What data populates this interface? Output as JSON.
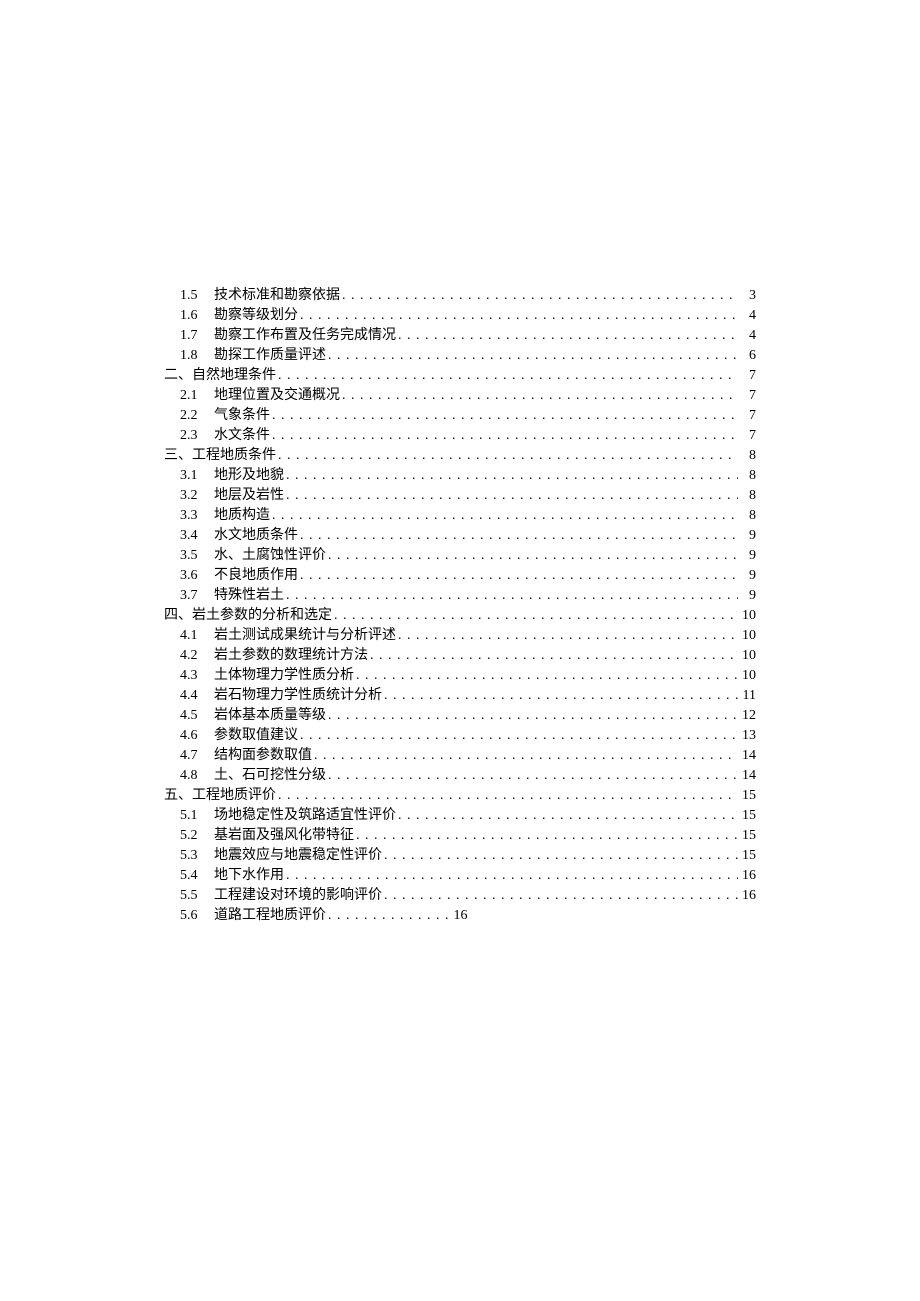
{
  "toc": [
    {
      "type": "sub",
      "num": "1.5",
      "title": "技术标准和勘察依据",
      "page": "3"
    },
    {
      "type": "sub",
      "num": "1.6",
      "title": "勘察等级划分",
      "page": "4"
    },
    {
      "type": "sub",
      "num": "1.7",
      "title": "勘察工作布置及任务完成情况",
      "page": "4"
    },
    {
      "type": "sub",
      "num": "1.8",
      "title": "勘探工作质量评述",
      "page": "6"
    },
    {
      "type": "section",
      "num": "二、",
      "title": "自然地理条件",
      "page": "7"
    },
    {
      "type": "sub",
      "num": "2.1",
      "title": "地理位置及交通概况",
      "page": "7"
    },
    {
      "type": "sub",
      "num": "2.2",
      "title": "气象条件",
      "page": "7"
    },
    {
      "type": "sub",
      "num": "2.3",
      "title": "水文条件",
      "page": "7"
    },
    {
      "type": "section",
      "num": "三、",
      "title": "工程地质条件",
      "page": "8"
    },
    {
      "type": "sub",
      "num": "3.1",
      "title": "地形及地貌",
      "page": "8"
    },
    {
      "type": "sub",
      "num": "3.2",
      "title": "地层及岩性",
      "page": "8"
    },
    {
      "type": "sub",
      "num": "3.3",
      "title": "地质构造",
      "page": "8"
    },
    {
      "type": "sub",
      "num": "3.4",
      "title": "水文地质条件",
      "page": "9"
    },
    {
      "type": "sub",
      "num": "3.5",
      "title": "水、土腐蚀性评价",
      "page": "9"
    },
    {
      "type": "sub",
      "num": "3.6",
      "title": "不良地质作用",
      "page": "9"
    },
    {
      "type": "sub",
      "num": "3.7",
      "title": "特殊性岩土",
      "page": "9"
    },
    {
      "type": "section",
      "num": "四、",
      "title": "岩土参数的分析和选定",
      "page": "10"
    },
    {
      "type": "sub",
      "num": "4.1",
      "title": "岩土测试成果统计与分析评述",
      "page": "10"
    },
    {
      "type": "sub",
      "num": "4.2",
      "title": "岩土参数的数理统计方法",
      "page": "10"
    },
    {
      "type": "sub",
      "num": "4.3",
      "title": "土体物理力学性质分析",
      "page": "10"
    },
    {
      "type": "sub",
      "num": "4.4",
      "title": "岩石物理力学性质统计分析",
      "page": "11"
    },
    {
      "type": "sub",
      "num": "4.5",
      "title": "岩体基本质量等级",
      "page": "12"
    },
    {
      "type": "sub",
      "num": "4.6",
      "title": "参数取值建议",
      "page": "13"
    },
    {
      "type": "sub",
      "num": "4.7",
      "title": "结构面参数取值",
      "page": "14"
    },
    {
      "type": "sub",
      "num": "4.8",
      "title": "土、石可挖性分级",
      "page": "14"
    },
    {
      "type": "section",
      "num": "五、",
      "title": "工程地质评价",
      "page": "15"
    },
    {
      "type": "sub",
      "num": "5.1",
      "title": "场地稳定性及筑路适宜性评价",
      "page": "15"
    },
    {
      "type": "sub",
      "num": "5.2",
      "title": "基岩面及强风化带特征",
      "page": "15"
    },
    {
      "type": "sub",
      "num": "5.3",
      "title": "地震效应与地震稳定性评价",
      "page": "15"
    },
    {
      "type": "sub",
      "num": "5.4",
      "title": "地下水作用",
      "page": "16"
    },
    {
      "type": "sub",
      "num": "5.5",
      "title": "工程建设对环境的影响评价",
      "page": "16"
    },
    {
      "type": "sub-short",
      "num": "5.6",
      "title": "道路工程地质评价",
      "page": "16"
    }
  ],
  "dots_long": ". . . . . . . . . . . . . . . . . . . . . . . . . . . . . . . . . . . . . . . . . . . . . . . . . . . . . . . . . . . . . . . . . . . . . . . . . . . . . . . . . . . . . . . . . . . . . . . . . . . .",
  "dots_short": ". . . . . . . . . . . . . ."
}
